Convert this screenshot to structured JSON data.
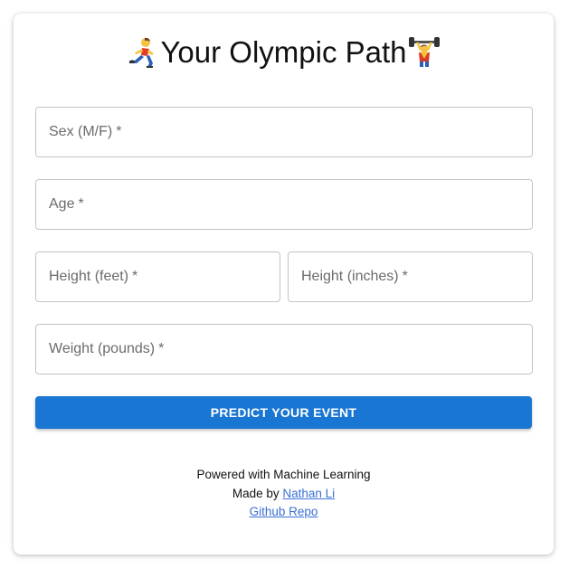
{
  "header": {
    "title": "Your Olympic Path",
    "left_icon": "runner-icon",
    "right_icon": "weightlifter-icon"
  },
  "form": {
    "sex": {
      "label": "Sex (M/F)",
      "required_mark": "*",
      "value": ""
    },
    "age": {
      "label": "Age",
      "required_mark": "*",
      "value": ""
    },
    "height_feet": {
      "label": "Height (feet)",
      "required_mark": "*",
      "value": ""
    },
    "height_inches": {
      "label": "Height (inches)",
      "required_mark": "*",
      "value": ""
    },
    "weight": {
      "label": "Weight (pounds)",
      "required_mark": "*",
      "value": ""
    },
    "submit_label": "PREDICT YOUR EVENT"
  },
  "footer": {
    "powered": "Powered with Machine Learning",
    "made_by_prefix": "Made by",
    "author_link": "Nathan Li",
    "repo_link": "Github Repo"
  },
  "colors": {
    "accent": "#1976d2",
    "link": "#3b6fd6",
    "border": "#c4c4c4"
  }
}
